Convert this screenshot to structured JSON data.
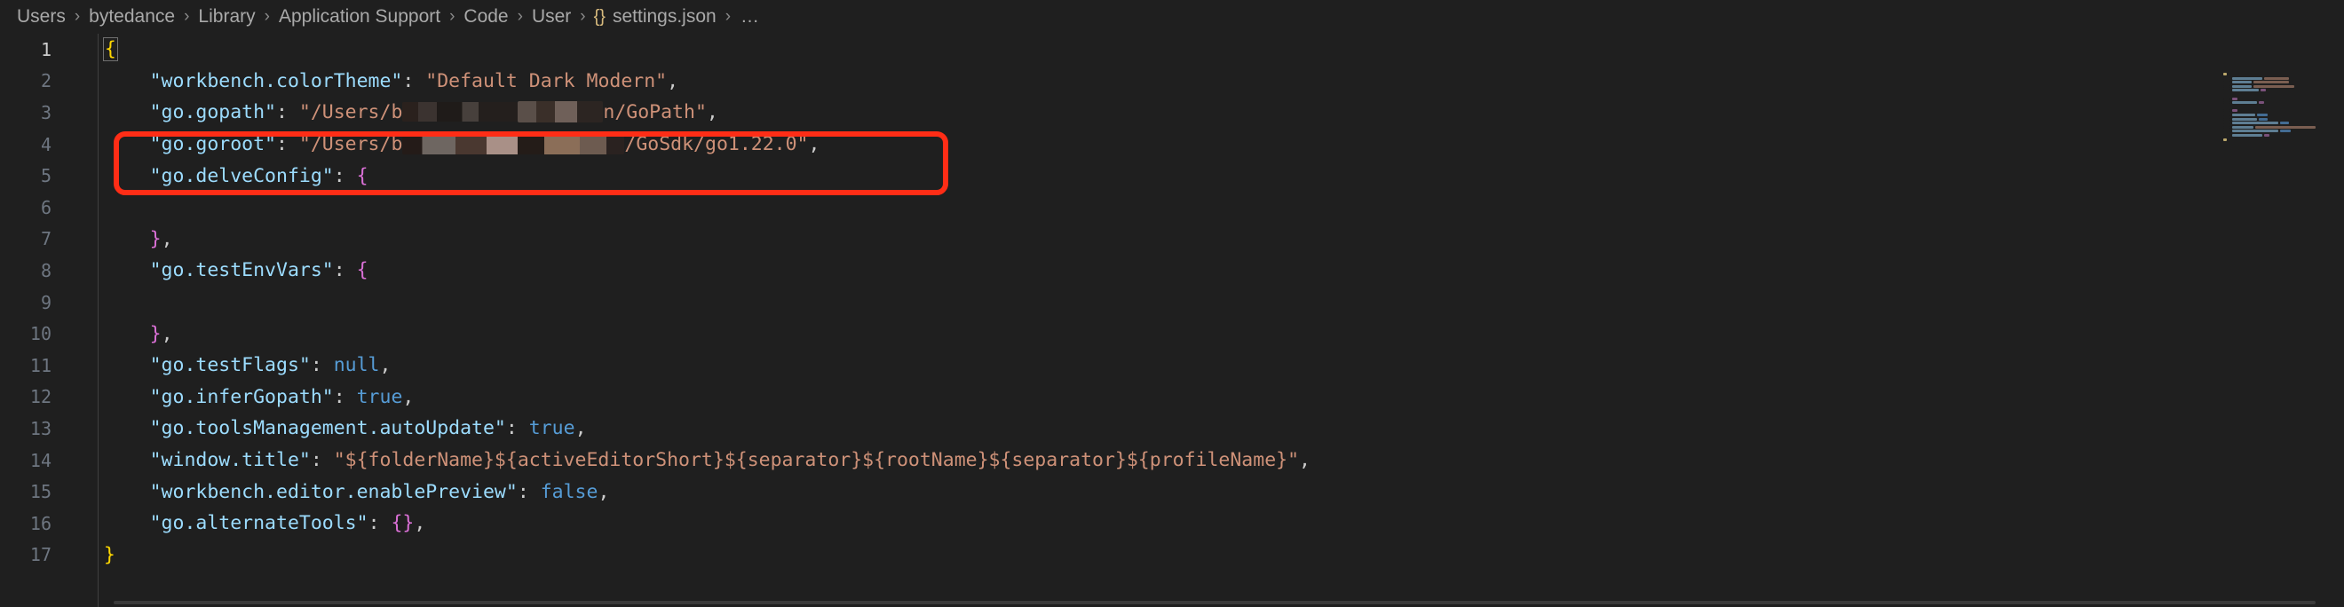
{
  "breadcrumb": {
    "separator": "›",
    "file_icon": "{}",
    "ellipsis": "…",
    "items": [
      {
        "label": "Users"
      },
      {
        "label": "bytedance"
      },
      {
        "label": "Library"
      },
      {
        "label": "Application Support"
      },
      {
        "label": "Code"
      },
      {
        "label": "User"
      },
      {
        "label": "settings.json",
        "icon": "{}"
      }
    ]
  },
  "editor": {
    "language": "json",
    "file_name": "settings.json",
    "colors": {
      "background": "#1f1f1f",
      "line_number": "#6e7681",
      "property_key": "#9cdcfe",
      "string": "#ce9178",
      "keyword": "#569cd6",
      "punctuation": "#cccccc",
      "brace_level1": "#ffd700",
      "brace_level2": "#da70d6",
      "annotation_box": "#ff2d16"
    },
    "lines": [
      {
        "num": "1",
        "indent": 0,
        "tokens": [
          {
            "t": "brace1-box",
            "v": "{"
          }
        ]
      },
      {
        "num": "2",
        "indent": 1,
        "tokens": [
          {
            "t": "key",
            "v": "\"workbench.colorTheme\""
          },
          {
            "t": "punct",
            "v": ": "
          },
          {
            "t": "str",
            "v": "\"Default Dark Modern\""
          },
          {
            "t": "punct",
            "v": ","
          }
        ]
      },
      {
        "num": "3",
        "indent": 1,
        "tokens": [
          {
            "t": "key",
            "v": "\"go.gopath\""
          },
          {
            "t": "punct",
            "v": ": "
          },
          {
            "t": "str",
            "v": "\"/Users/b"
          },
          {
            "t": "redact",
            "v": "rd-a"
          },
          {
            "t": "redact",
            "v": "rd-b"
          },
          {
            "t": "str",
            "v": "n/GoPath\""
          },
          {
            "t": "punct",
            "v": ","
          }
        ]
      },
      {
        "num": "4",
        "indent": 1,
        "tokens": [
          {
            "t": "key",
            "v": "\"go.goroot\""
          },
          {
            "t": "punct",
            "v": ": "
          },
          {
            "t": "str",
            "v": "\"/Users/b"
          },
          {
            "t": "redact",
            "v": "rd-c"
          },
          {
            "t": "str",
            "v": "/GoSdk/go1.22.0\""
          },
          {
            "t": "punct",
            "v": ","
          }
        ]
      },
      {
        "num": "5",
        "indent": 1,
        "tokens": [
          {
            "t": "key",
            "v": "\"go.delveConfig\""
          },
          {
            "t": "punct",
            "v": ": "
          },
          {
            "t": "brace2",
            "v": "{"
          }
        ]
      },
      {
        "num": "6",
        "indent": 1,
        "tokens": []
      },
      {
        "num": "7",
        "indent": 1,
        "tokens": [
          {
            "t": "brace2",
            "v": "}"
          },
          {
            "t": "punct",
            "v": ","
          }
        ]
      },
      {
        "num": "8",
        "indent": 1,
        "tokens": [
          {
            "t": "key",
            "v": "\"go.testEnvVars\""
          },
          {
            "t": "punct",
            "v": ": "
          },
          {
            "t": "brace2",
            "v": "{"
          }
        ]
      },
      {
        "num": "9",
        "indent": 1,
        "tokens": []
      },
      {
        "num": "10",
        "indent": 1,
        "tokens": [
          {
            "t": "brace2",
            "v": "}"
          },
          {
            "t": "punct",
            "v": ","
          }
        ]
      },
      {
        "num": "11",
        "indent": 1,
        "tokens": [
          {
            "t": "key",
            "v": "\"go.testFlags\""
          },
          {
            "t": "punct",
            "v": ": "
          },
          {
            "t": "kw",
            "v": "null"
          },
          {
            "t": "punct",
            "v": ","
          }
        ]
      },
      {
        "num": "12",
        "indent": 1,
        "tokens": [
          {
            "t": "key",
            "v": "\"go.inferGopath\""
          },
          {
            "t": "punct",
            "v": ": "
          },
          {
            "t": "kw",
            "v": "true"
          },
          {
            "t": "punct",
            "v": ","
          }
        ]
      },
      {
        "num": "13",
        "indent": 1,
        "tokens": [
          {
            "t": "key",
            "v": "\"go.toolsManagement.autoUpdate\""
          },
          {
            "t": "punct",
            "v": ": "
          },
          {
            "t": "kw",
            "v": "true"
          },
          {
            "t": "punct",
            "v": ","
          }
        ]
      },
      {
        "num": "14",
        "indent": 1,
        "tokens": [
          {
            "t": "key",
            "v": "\"window.title\""
          },
          {
            "t": "punct",
            "v": ": "
          },
          {
            "t": "str",
            "v": "\"${folderName}${activeEditorShort}${separator}${rootName}${separator}${profileName}\""
          },
          {
            "t": "punct",
            "v": ","
          }
        ]
      },
      {
        "num": "15",
        "indent": 1,
        "tokens": [
          {
            "t": "key",
            "v": "\"workbench.editor.enablePreview\""
          },
          {
            "t": "punct",
            "v": ": "
          },
          {
            "t": "kw",
            "v": "false"
          },
          {
            "t": "punct",
            "v": ","
          }
        ]
      },
      {
        "num": "16",
        "indent": 1,
        "tokens": [
          {
            "t": "key",
            "v": "\"go.alternateTools\""
          },
          {
            "t": "punct",
            "v": ": "
          },
          {
            "t": "brace2",
            "v": "{}"
          },
          {
            "t": "punct",
            "v": ","
          }
        ]
      },
      {
        "num": "17",
        "indent": 0,
        "tokens": [
          {
            "t": "brace1",
            "v": "}"
          }
        ]
      }
    ]
  },
  "minimap": {
    "rows": [
      [
        {
          "w": 4,
          "c": "#d7c07a"
        }
      ],
      [
        {
          "w": 8,
          "c": "#1f1f1f"
        },
        {
          "w": 34,
          "c": "#6a8fa8"
        },
        {
          "w": 28,
          "c": "#8a6a5a"
        }
      ],
      [
        {
          "w": 8,
          "c": "#1f1f1f"
        },
        {
          "w": 22,
          "c": "#6a8fa8"
        },
        {
          "w": 40,
          "c": "#8a6a5a"
        }
      ],
      [
        {
          "w": 8,
          "c": "#1f1f1f"
        },
        {
          "w": 22,
          "c": "#6a8fa8"
        },
        {
          "w": 46,
          "c": "#8a6a5a"
        }
      ],
      [
        {
          "w": 8,
          "c": "#1f1f1f"
        },
        {
          "w": 30,
          "c": "#6a8fa8"
        },
        {
          "w": 6,
          "c": "#8a5a8a"
        }
      ],
      [],
      [
        {
          "w": 8,
          "c": "#1f1f1f"
        },
        {
          "w": 6,
          "c": "#8a5a8a"
        }
      ],
      [
        {
          "w": 8,
          "c": "#1f1f1f"
        },
        {
          "w": 28,
          "c": "#6a8fa8"
        },
        {
          "w": 6,
          "c": "#8a5a8a"
        }
      ],
      [],
      [
        {
          "w": 8,
          "c": "#1f1f1f"
        },
        {
          "w": 6,
          "c": "#8a5a8a"
        }
      ],
      [
        {
          "w": 8,
          "c": "#1f1f1f"
        },
        {
          "w": 26,
          "c": "#6a8fa8"
        },
        {
          "w": 12,
          "c": "#4a7aa8"
        }
      ],
      [
        {
          "w": 8,
          "c": "#1f1f1f"
        },
        {
          "w": 28,
          "c": "#6a8fa8"
        },
        {
          "w": 10,
          "c": "#4a7aa8"
        }
      ],
      [
        {
          "w": 8,
          "c": "#1f1f1f"
        },
        {
          "w": 52,
          "c": "#6a8fa8"
        },
        {
          "w": 10,
          "c": "#4a7aa8"
        }
      ],
      [
        {
          "w": 8,
          "c": "#1f1f1f"
        },
        {
          "w": 24,
          "c": "#6a8fa8"
        },
        {
          "w": 68,
          "c": "#8a6a5a"
        }
      ],
      [
        {
          "w": 8,
          "c": "#1f1f1f"
        },
        {
          "w": 52,
          "c": "#6a8fa8"
        },
        {
          "w": 12,
          "c": "#4a7aa8"
        }
      ],
      [
        {
          "w": 8,
          "c": "#1f1f1f"
        },
        {
          "w": 34,
          "c": "#6a8fa8"
        },
        {
          "w": 6,
          "c": "#8a5a8a"
        }
      ],
      [
        {
          "w": 4,
          "c": "#d7c07a"
        }
      ]
    ]
  }
}
